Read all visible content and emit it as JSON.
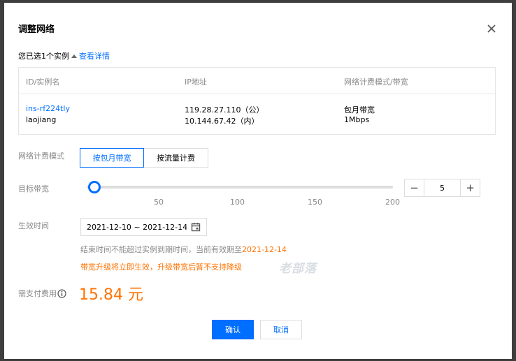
{
  "dialog": {
    "title": "调整网络",
    "selected_text": "您已选1个实例",
    "details_link": "查看详情"
  },
  "table": {
    "headers": [
      "ID/实例名",
      "IP地址",
      "网络计费模式/带宽"
    ],
    "row": {
      "id": "ins-rf224tly",
      "name": "laojiang",
      "ip_public": "119.28.27.110（公）",
      "ip_private": "10.144.67.42（内）",
      "billing": "包月带宽",
      "bandwidth": "1Mbps"
    }
  },
  "billing_mode": {
    "label": "网络计费模式",
    "options": [
      "按包月带宽",
      "按流量计费"
    ],
    "selected": "按包月带宽"
  },
  "bandwidth": {
    "label": "目标带宽",
    "ticks": [
      "50",
      "100",
      "150",
      "200"
    ],
    "value": "5",
    "min": 1,
    "max": 200,
    "minus": "−",
    "plus": "+"
  },
  "effective_time": {
    "label": "生效时间",
    "range": "2021-12-10 ~ 2021-12-14",
    "note_prefix": "结束时间不能超过实例到期时间，当前有效期至",
    "note_date": "2021-12-14",
    "warning": "带宽升级将立即生效，升级带宽后暂不支持降级"
  },
  "watermark": "老部落",
  "fee": {
    "label": "需支付费用",
    "amount": "15.84 元"
  },
  "buttons": {
    "confirm": "确认",
    "cancel": "取消"
  },
  "colors": {
    "accent": "#006eff",
    "warning": "#ff7200"
  }
}
